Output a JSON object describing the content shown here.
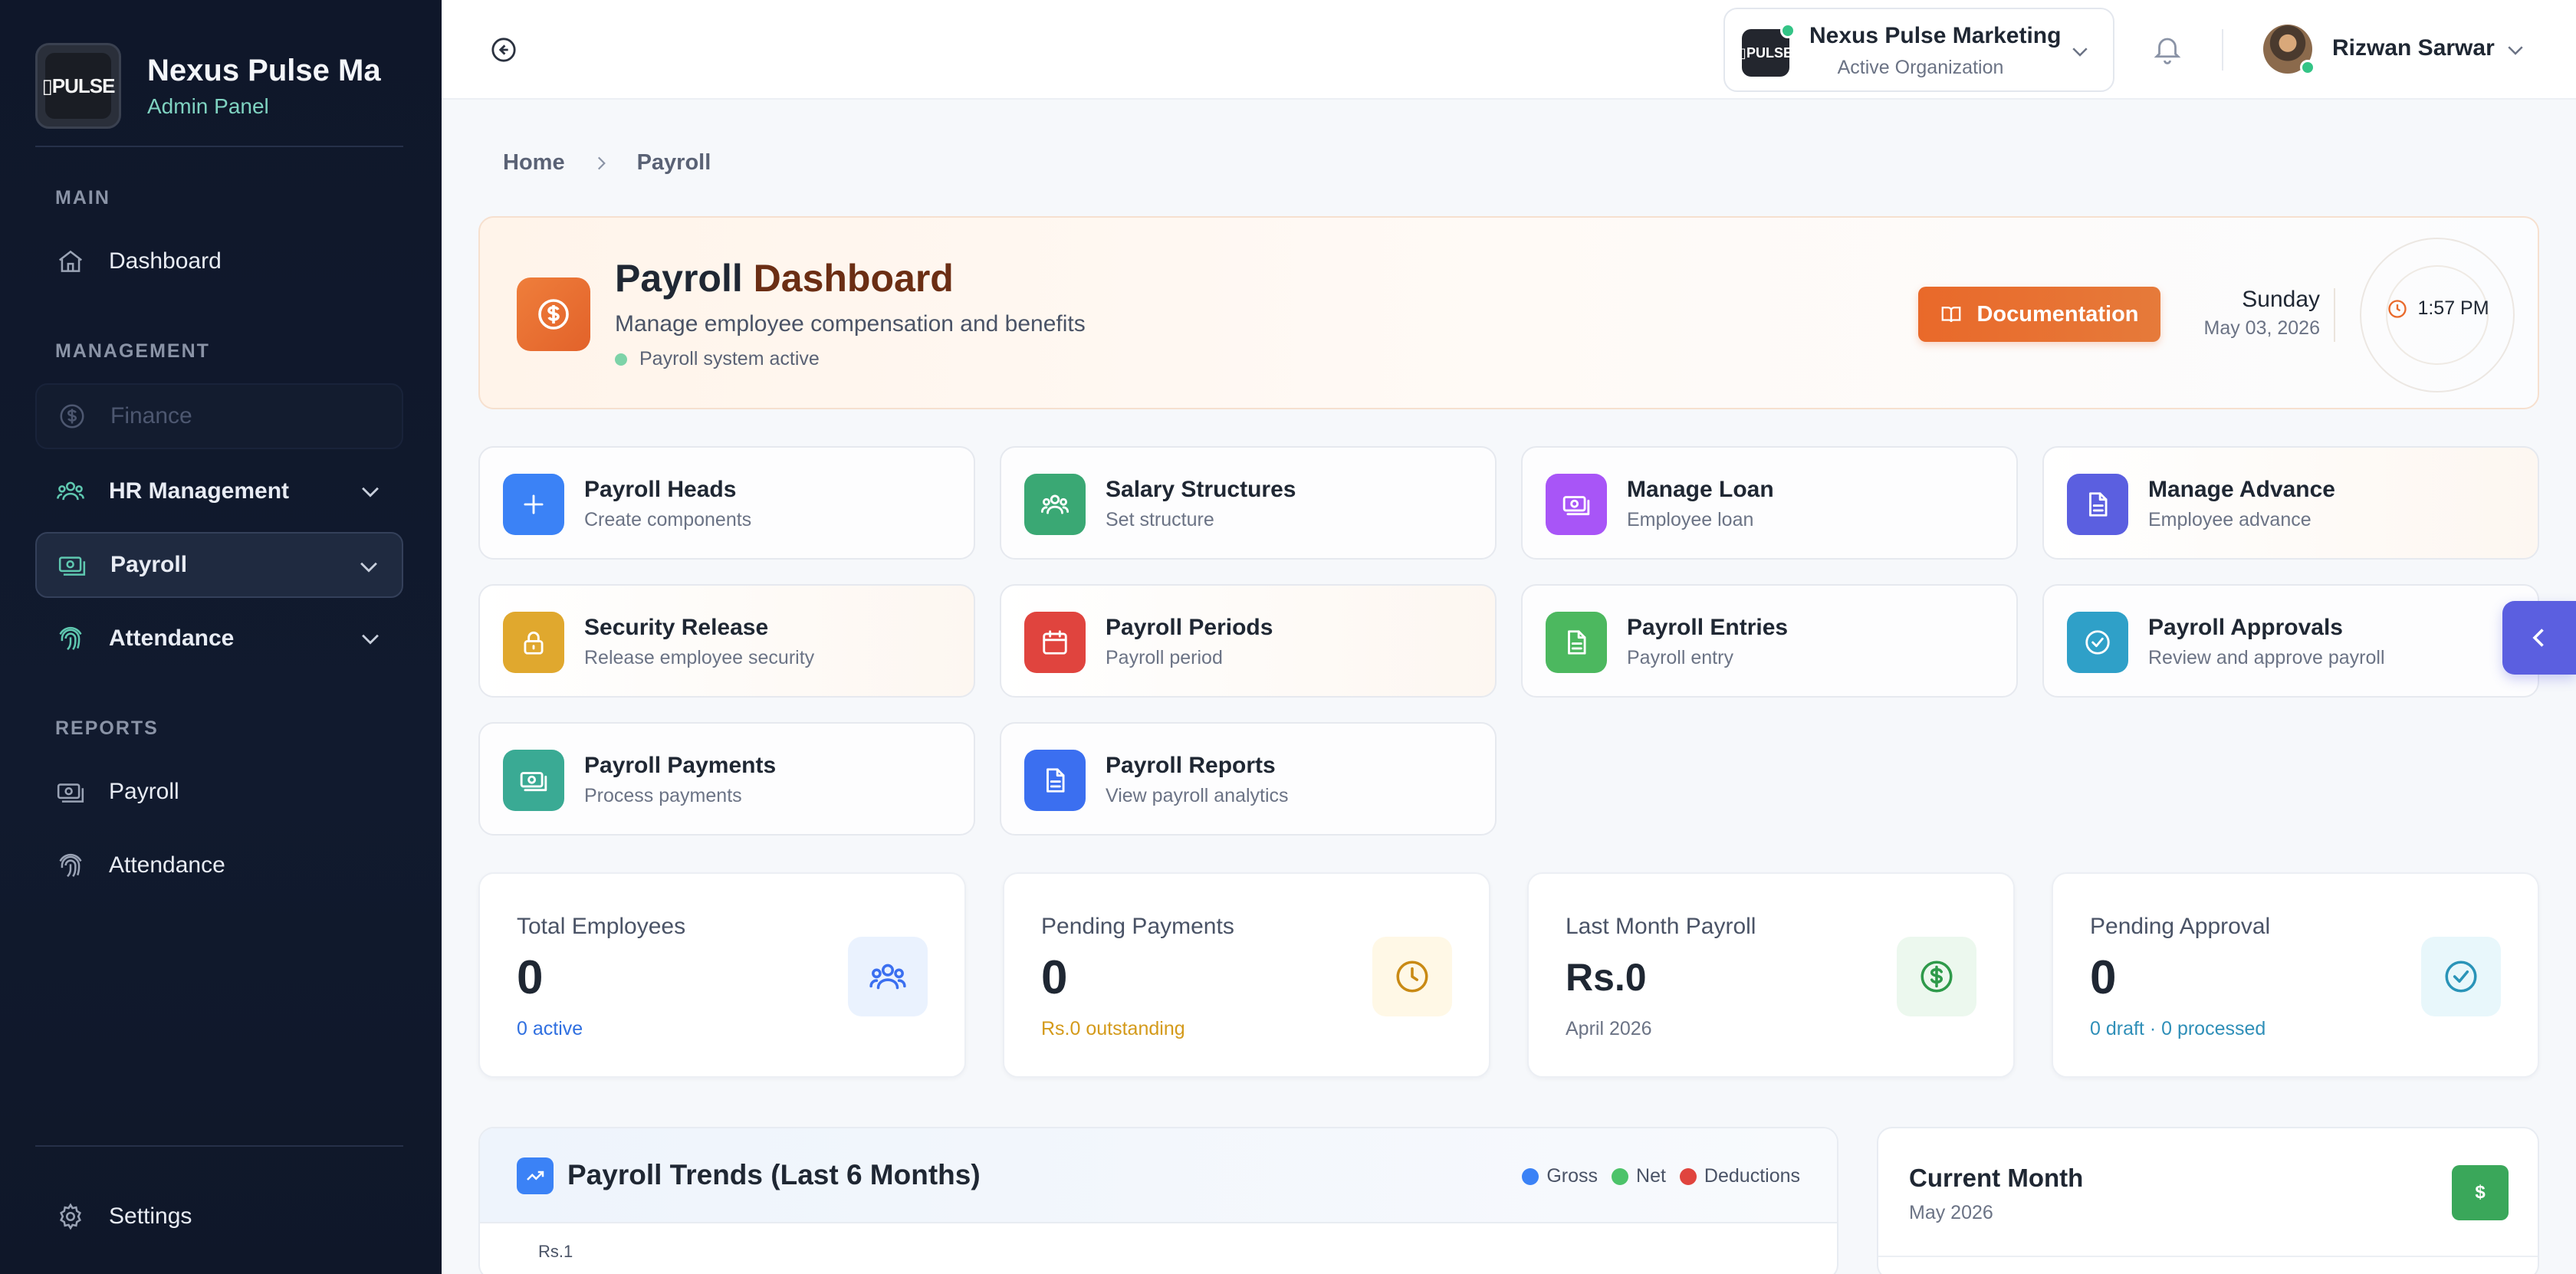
{
  "sidebar": {
    "brand": {
      "logo_text": "▯PULSE",
      "title": "Nexus Pulse Ma",
      "subtitle": "Admin Panel"
    },
    "sections": {
      "main": "MAIN",
      "management": "MANAGEMENT",
      "reports": "REPORTS"
    },
    "items": {
      "dashboard": "Dashboard",
      "finance": "Finance",
      "hr_management": "HR Management",
      "payroll": "Payroll",
      "attendance": "Attendance",
      "report_payroll": "Payroll",
      "report_attendance": "Attendance",
      "settings": "Settings"
    }
  },
  "header": {
    "org": {
      "logo_text": "▯PULSE",
      "name": "Nexus Pulse Marketing",
      "subtitle": "Active Organization"
    },
    "user": {
      "name": "Rizwan Sarwar"
    }
  },
  "breadcrumb": {
    "home": "Home",
    "current": "Payroll"
  },
  "hero": {
    "title_part1": "Payroll",
    "title_part2": "Dashboard",
    "subtitle": "Manage employee compensation and benefits",
    "status": "Payroll system active",
    "doc_button": "Documentation",
    "day": "Sunday",
    "date": "May 03, 2026",
    "time": "1:57 PM"
  },
  "quick_links": [
    {
      "title": "Payroll Heads",
      "subtitle": "Create components",
      "icon": "plus-icon",
      "color": "#3b82f6"
    },
    {
      "title": "Salary Structures",
      "subtitle": "Set structure",
      "icon": "users-icon",
      "color": "#3aa874"
    },
    {
      "title": "Manage Loan",
      "subtitle": "Employee loan",
      "icon": "cash-icon",
      "color": "#a855f7"
    },
    {
      "title": "Manage Advance",
      "subtitle": "Employee advance",
      "icon": "document-icon",
      "color": "#5b5fe0"
    },
    {
      "title": "Security Release",
      "subtitle": "Release employee security",
      "icon": "lock-icon",
      "color": "#e0a82e"
    },
    {
      "title": "Payroll Periods",
      "subtitle": "Payroll period",
      "icon": "calendar-icon",
      "color": "#e0443e"
    },
    {
      "title": "Payroll Entries",
      "subtitle": "Payroll entry",
      "icon": "document-icon",
      "color": "#4cb85f"
    },
    {
      "title": "Payroll Approvals",
      "subtitle": "Review and approve payroll",
      "icon": "check-circle-icon",
      "color": "#2fa0c8"
    },
    {
      "title": "Payroll Payments",
      "subtitle": "Process payments",
      "icon": "cash-icon",
      "color": "#3aaa94"
    },
    {
      "title": "Payroll Reports",
      "subtitle": "View payroll analytics",
      "icon": "document-icon",
      "color": "#3b6ff0"
    }
  ],
  "stats": [
    {
      "label": "Total Employees",
      "value": "0",
      "foot": "0 active",
      "foot_color": "#2f6fe0",
      "icon": "users-icon",
      "icon_bg": "#eaf2fe",
      "icon_color": "#3b6ff0"
    },
    {
      "label": "Pending Payments",
      "value": "0",
      "foot": "Rs.0 outstanding",
      "foot_color": "#d49a1a",
      "icon": "clock-icon",
      "icon_bg": "#fff8e6",
      "icon_color": "#c98a14"
    },
    {
      "label": "Last Month Payroll",
      "value": "Rs.0",
      "foot": "April 2026",
      "foot_color": "#6b7385",
      "icon": "dollar-icon",
      "icon_bg": "#ecf8ee",
      "icon_color": "#2e9a4a"
    },
    {
      "label": "Pending Approval",
      "value": "0",
      "foot": "0 draft · 0 processed",
      "foot_color": "#2f8fb8",
      "icon": "check-circle-icon",
      "icon_bg": "#e8f7fb",
      "icon_color": "#2a94b8"
    }
  ],
  "trends": {
    "title": "Payroll Trends (Last 6 Months)",
    "legend": [
      {
        "label": "Gross",
        "color": "#3b82f6"
      },
      {
        "label": "Net",
        "color": "#4cc36a"
      },
      {
        "label": "Deductions",
        "color": "#e0443e"
      }
    ],
    "axis_top": "Rs.1"
  },
  "current_month": {
    "title": "Current Month",
    "subtitle": "May 2026",
    "badge": "$"
  }
}
